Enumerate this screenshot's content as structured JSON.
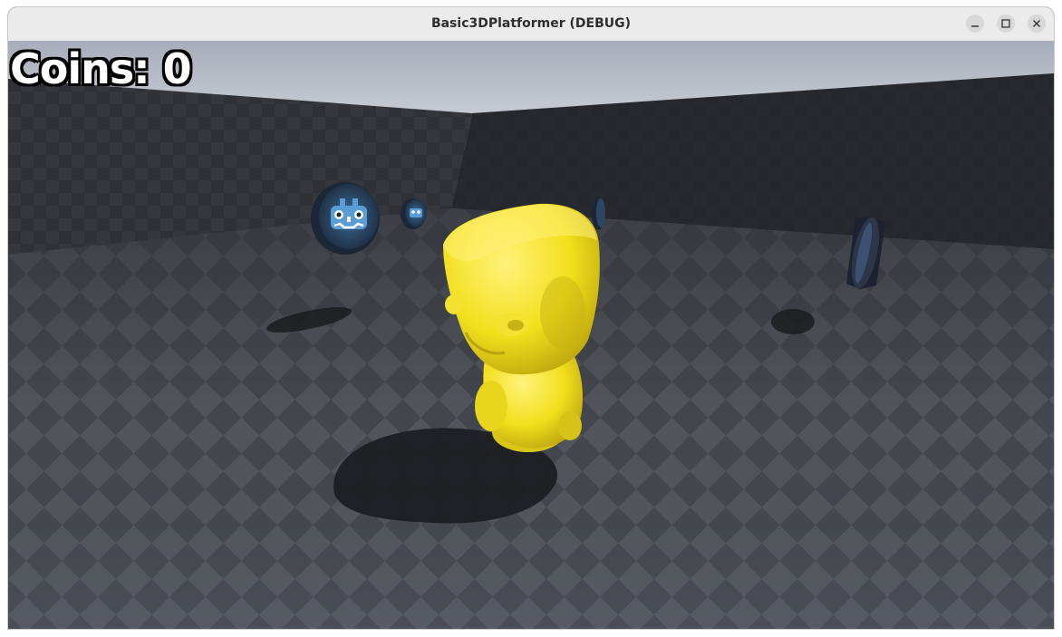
{
  "window": {
    "title": "Basic3DPlatformer (DEBUG)",
    "controls": {
      "minimize": "minimize-icon",
      "maximize": "maximize-icon",
      "close": "close-icon"
    }
  },
  "hud": {
    "coins_label": "Coins: 0"
  },
  "scene": {
    "sky_color": "#c3c7d1",
    "floor_color_light": "#55585f",
    "floor_color_dark": "#3c3f46",
    "character_color": "#f1e01c",
    "coin_icon": "godot-logo-icon",
    "coin_count_visible": 4
  }
}
